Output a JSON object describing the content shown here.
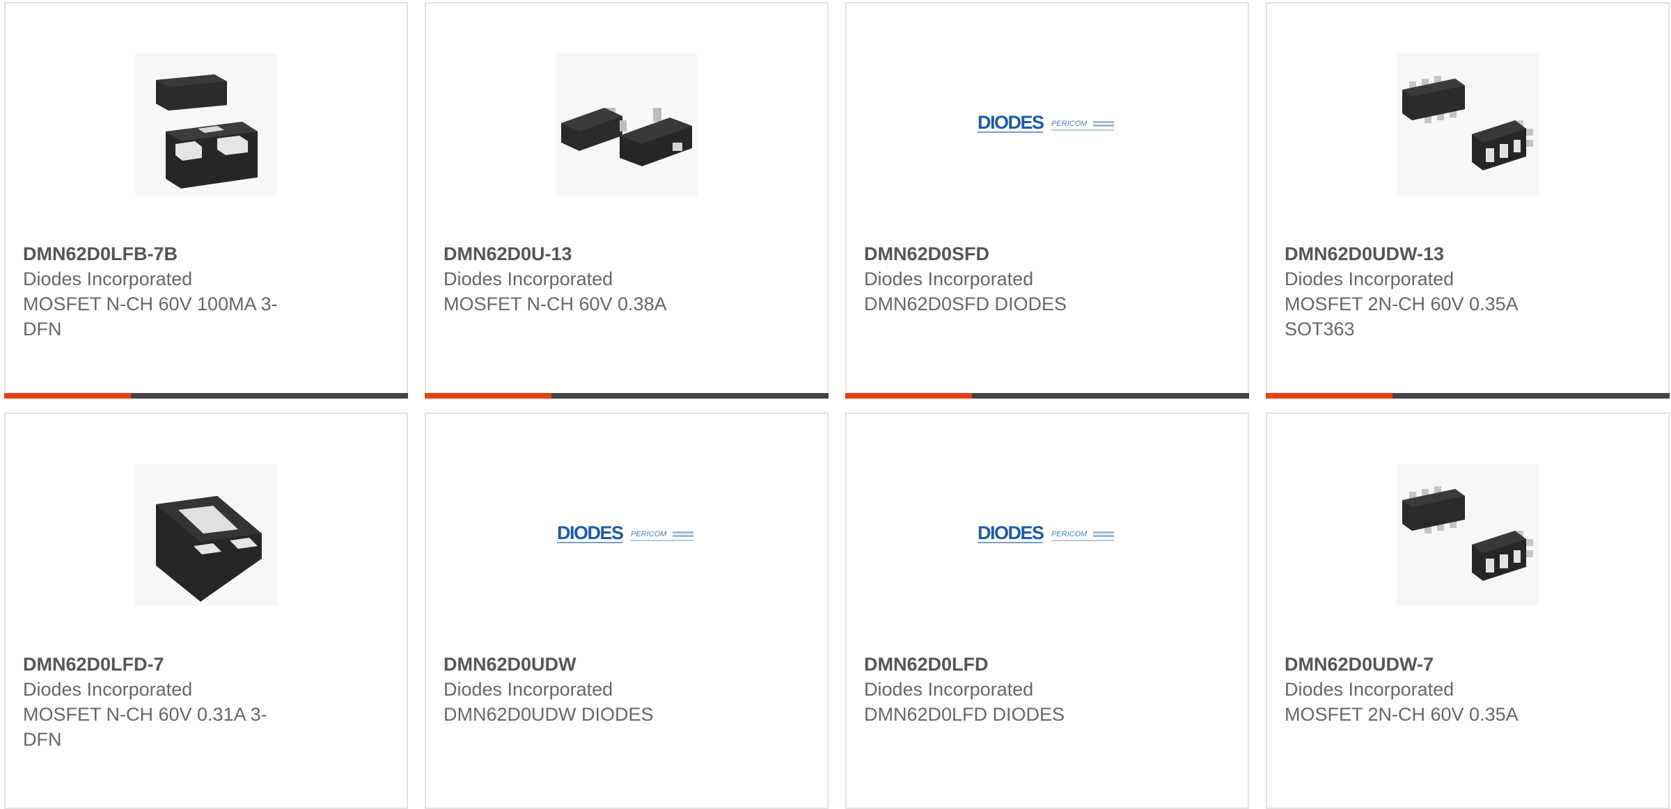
{
  "colors": {
    "accent_orange": "#e8410f",
    "accent_dark": "#444444",
    "card_border": "#e2e2e2",
    "text": "#666666",
    "diodes_blue": "#1f5aa6"
  },
  "products": [
    {
      "part_number": "DMN62D0LFB-7B",
      "manufacturer": "Diodes Incorporated",
      "description": "MOSFET N-CH 60V 100MA 3-DFN",
      "image_type": "dfn-package-pair"
    },
    {
      "part_number": "DMN62D0U-13",
      "manufacturer": "Diodes Incorporated",
      "description": "MOSFET N-CH 60V 0.38A",
      "image_type": "sot23-package-pair"
    },
    {
      "part_number": "DMN62D0SFD",
      "manufacturer": "Diodes Incorporated",
      "description": "DMN62D0SFD DIODES",
      "image_type": "diodes-pericom-logo",
      "logo": {
        "brand": "DIODES",
        "sub": "PERICOM"
      }
    },
    {
      "part_number": "DMN62D0UDW-13",
      "manufacturer": "Diodes Incorporated",
      "description": "MOSFET 2N-CH 60V 0.35A SOT363",
      "image_type": "sot363-package-pair"
    },
    {
      "part_number": "DMN62D0LFD-7",
      "manufacturer": "Diodes Incorporated",
      "description": "MOSFET N-CH 60V 0.31A 3-DFN",
      "image_type": "dfn-package-single"
    },
    {
      "part_number": "DMN62D0UDW",
      "manufacturer": "Diodes Incorporated",
      "description": "DMN62D0UDW DIODES",
      "image_type": "diodes-pericom-logo",
      "logo": {
        "brand": "DIODES",
        "sub": "PERICOM"
      }
    },
    {
      "part_number": "DMN62D0LFD",
      "manufacturer": "Diodes Incorporated",
      "description": "DMN62D0LFD DIODES",
      "image_type": "diodes-pericom-logo",
      "logo": {
        "brand": "DIODES",
        "sub": "PERICOM"
      }
    },
    {
      "part_number": "DMN62D0UDW-7",
      "manufacturer": "Diodes Incorporated",
      "description": "MOSFET 2N-CH 60V 0.35A",
      "image_type": "sot363-package-pair"
    }
  ]
}
